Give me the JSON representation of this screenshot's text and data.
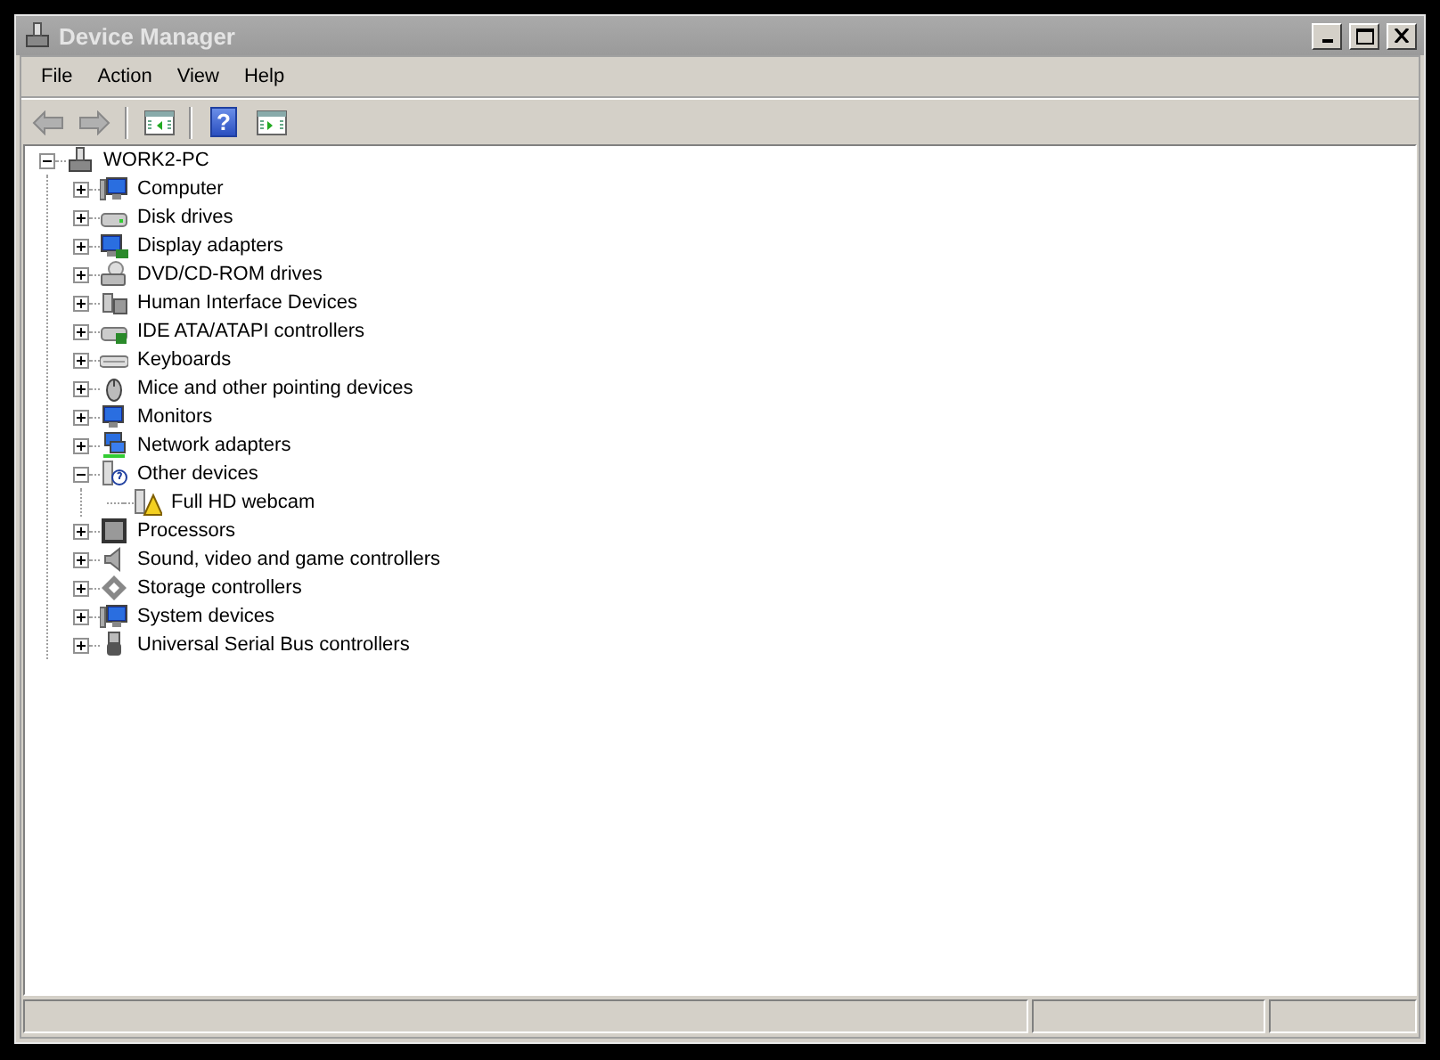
{
  "window": {
    "title": "Device Manager"
  },
  "menu": [
    "File",
    "Action",
    "View",
    "Help"
  ],
  "toolbar": {
    "back": {
      "disabled": true
    },
    "forward": {
      "disabled": true
    },
    "help": {
      "label": "?"
    }
  },
  "tree": {
    "label": "WORK2-PC",
    "expanded": true,
    "children": [
      {
        "label": "Computer",
        "expanded": false
      },
      {
        "label": "Disk drives",
        "expanded": false
      },
      {
        "label": "Display adapters",
        "expanded": false
      },
      {
        "label": "DVD/CD-ROM drives",
        "expanded": false
      },
      {
        "label": "Human Interface Devices",
        "expanded": false
      },
      {
        "label": "IDE ATA/ATAPI controllers",
        "expanded": false
      },
      {
        "label": "Keyboards",
        "expanded": false
      },
      {
        "label": "Mice and other pointing devices",
        "expanded": false
      },
      {
        "label": "Monitors",
        "expanded": false
      },
      {
        "label": "Network adapters",
        "expanded": false
      },
      {
        "label": "Other devices",
        "expanded": true,
        "children": [
          {
            "label": "Full HD webcam",
            "warning": true
          }
        ]
      },
      {
        "label": "Processors",
        "expanded": false
      },
      {
        "label": "Sound, video and game controllers",
        "expanded": false
      },
      {
        "label": "Storage controllers",
        "expanded": false
      },
      {
        "label": "System devices",
        "expanded": false
      },
      {
        "label": "Universal Serial Bus controllers",
        "expanded": false
      }
    ]
  }
}
